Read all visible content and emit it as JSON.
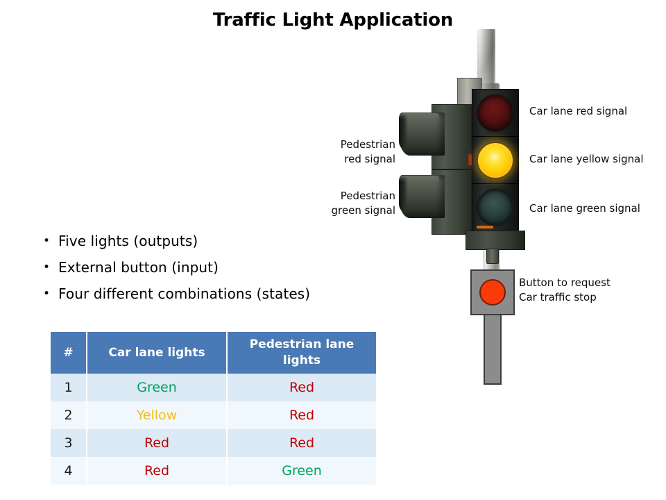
{
  "slide": {
    "title": "Traffic Light Application"
  },
  "bullets": [
    {
      "marker": "•",
      "text": "Five lights (outputs)"
    },
    {
      "marker": "•",
      "text": "External button (input)"
    },
    {
      "marker": "•",
      "text": "Four different combinations (states)"
    }
  ],
  "callouts": {
    "car_red": "Car lane red signal",
    "car_yellow": "Car lane yellow signal",
    "car_green": "Car lane green signal",
    "pedestrian_red": "Pedestrian\nred signal",
    "pedestrian_green": "Pedestrian\ngreen signal",
    "request_button": "Button to request\nCar traffic stop"
  },
  "table": {
    "headers": [
      "#",
      "Car lane lights",
      "Pedestrian lane lights"
    ],
    "rows": [
      {
        "num": "1",
        "car": "Green",
        "ped": "Red"
      },
      {
        "num": "2",
        "car": "Yellow",
        "ped": "Red"
      },
      {
        "num": "3",
        "car": "Red",
        "ped": "Red"
      },
      {
        "num": "4",
        "car": "Red",
        "ped": "Green"
      }
    ]
  },
  "colors": {
    "header_blue": "#4a7ab5",
    "row_odd": "#dceaf6",
    "row_even": "#f1f8fd",
    "text_red": "#c00000",
    "text_green": "#00a15a",
    "text_yellow": "#f5bb17",
    "lamp_yellow_on": "#ffcc07",
    "lamp_red_off": "#5a1212",
    "lamp_green_off": "#2d4440",
    "button_red": "#fb3a0a",
    "button_gray": "#8c8c8c"
  },
  "figure": {
    "lamps": [
      {
        "name": "car-lane-red-lamp",
        "state": "off"
      },
      {
        "name": "car-lane-yellow-lamp",
        "state": "on"
      },
      {
        "name": "car-lane-green-lamp",
        "state": "off"
      }
    ],
    "pedestrian_lamps": [
      {
        "name": "pedestrian-red-lamp",
        "state": "hooded"
      },
      {
        "name": "pedestrian-green-lamp",
        "state": "hooded"
      }
    ]
  }
}
